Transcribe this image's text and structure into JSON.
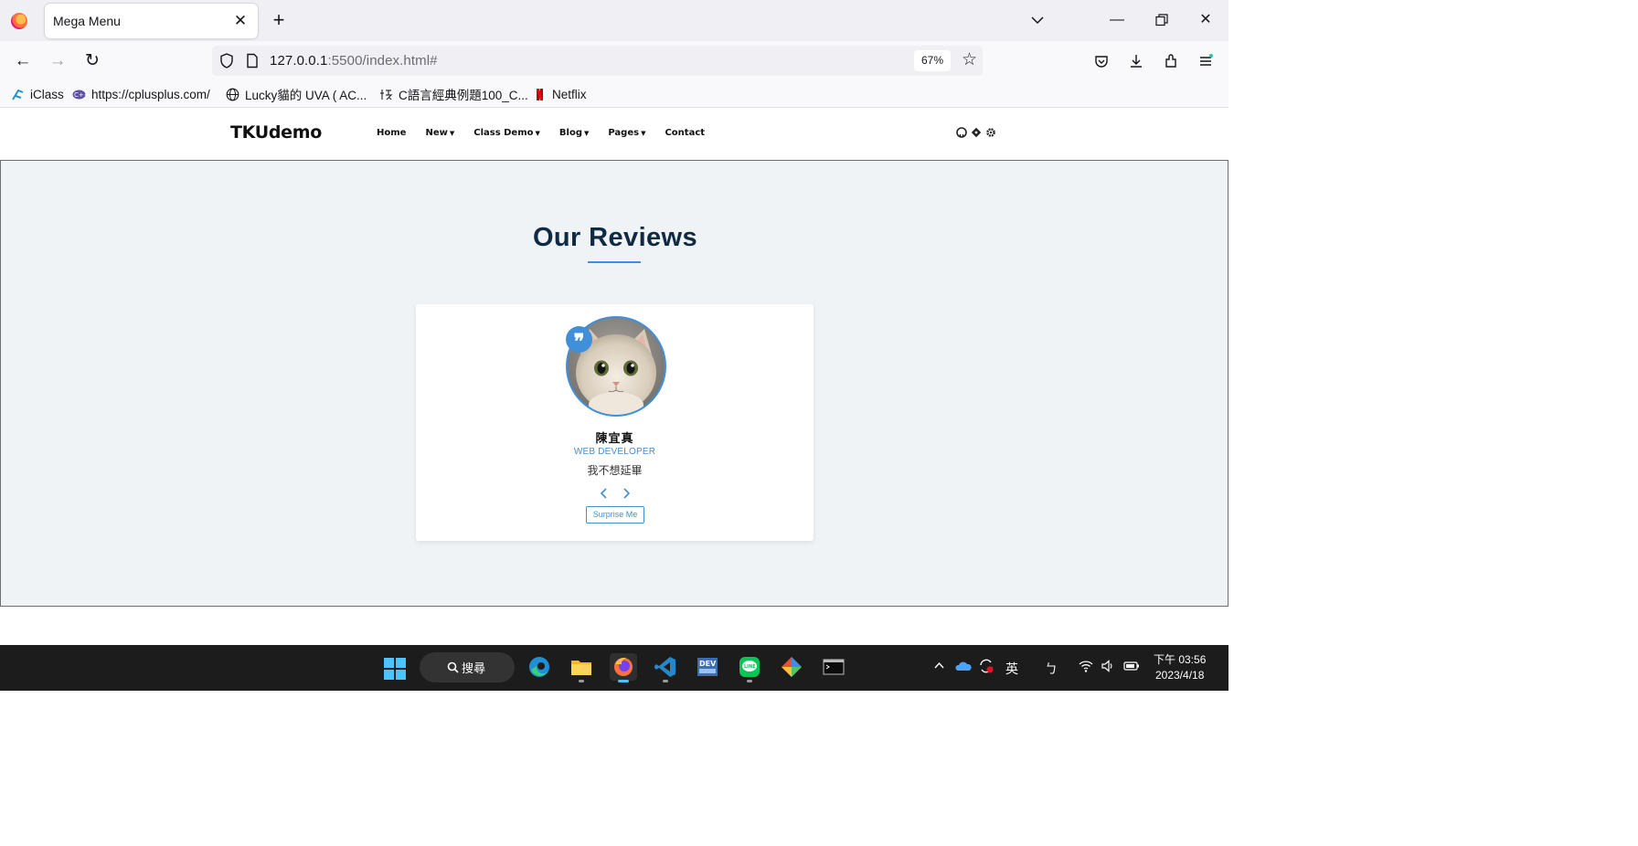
{
  "browser": {
    "tab_title": "Mega Menu",
    "url_host": "127.0.0.1",
    "url_path": ":5500/index.html#",
    "zoom": "67%",
    "bookmarks": [
      {
        "label": "iClass",
        "icon": "iclass-icon"
      },
      {
        "label": "https://cplusplus.com/",
        "icon": "cplusplus-icon"
      },
      {
        "label": "Lucky貓的 UVA ( AC...",
        "icon": "globe-icon"
      },
      {
        "label": "C語言經典例題100_C...",
        "icon": "site-icon"
      },
      {
        "label": "Netflix",
        "icon": "netflix-icon"
      }
    ]
  },
  "site": {
    "brand": "TKUdemo",
    "menu": [
      {
        "label": "Home",
        "has_dropdown": false
      },
      {
        "label": "New",
        "has_dropdown": true
      },
      {
        "label": "Class Demo",
        "has_dropdown": true
      },
      {
        "label": "Blog",
        "has_dropdown": true
      },
      {
        "label": "Pages",
        "has_dropdown": true
      },
      {
        "label": "Contact",
        "has_dropdown": false
      }
    ],
    "header_icons": [
      "github-icon",
      "git-icon",
      "gear-icon"
    ]
  },
  "reviews": {
    "title": "Our Reviews",
    "accent_color": "#3f8fd9",
    "person": {
      "name": "陳宜真",
      "job": "WEB DEVELOPER",
      "text": "我不想延畢"
    },
    "surprise_label": "Surprise Me"
  },
  "taskbar": {
    "search_label": "搜尋",
    "tray_ime": "英",
    "tray_ime2": "ㄅ",
    "clock_time": "下午 03:56",
    "clock_date": "2023/4/18"
  }
}
